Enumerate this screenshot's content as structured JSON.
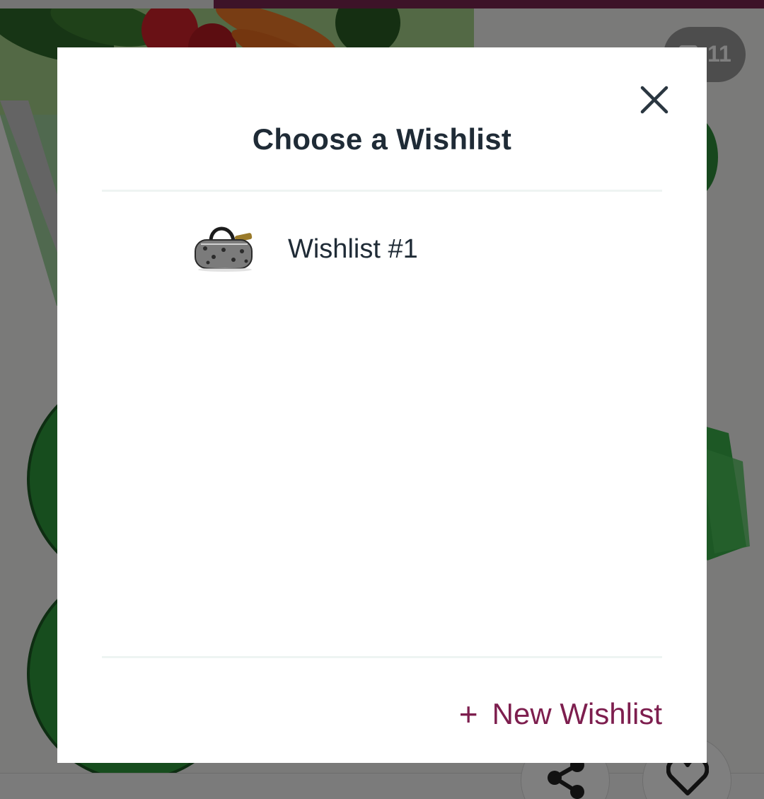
{
  "background": {
    "image_counter": "11",
    "icons": {
      "gallery": "gallery-icon",
      "share": "share-icon",
      "favorite": "heart-icon"
    },
    "progress_fraction": 0.28
  },
  "modal": {
    "title": "Choose a Wishlist",
    "close_icon": "close-icon",
    "wishlists": [
      {
        "name": "Wishlist #1",
        "thumbnail": "handbag-thumbnail"
      }
    ],
    "new_wishlist": {
      "icon": "plus-icon",
      "plus_glyph": "+",
      "label": "New Wishlist"
    }
  },
  "colors": {
    "brand": "#7d1e4e",
    "title_text": "#1f2b36",
    "progress_track": "#7a2650"
  }
}
